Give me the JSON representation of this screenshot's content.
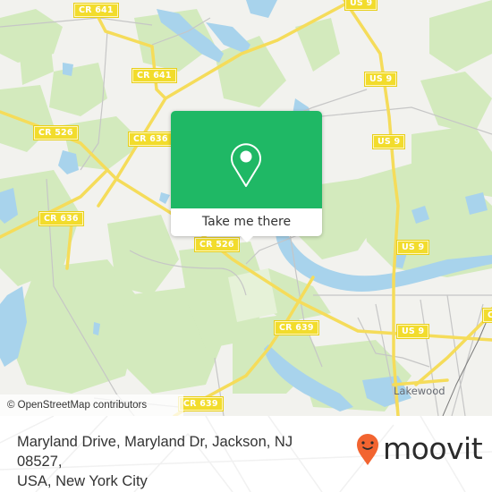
{
  "map": {
    "colors": {
      "land": "#f2f2ee",
      "forest": "#cfe8b4",
      "water": "#a8d3ec",
      "road_major": "#f7e27a",
      "road_minor": "#c8c8c8",
      "label_bg": "#f2dc2c"
    },
    "road_labels": [
      {
        "id": "cr641-top",
        "text": "CR 641"
      },
      {
        "id": "cr641-mid",
        "text": "CR 641"
      },
      {
        "id": "cr526-left",
        "text": "CR 526"
      },
      {
        "id": "cr636-top",
        "text": "CR 636"
      },
      {
        "id": "cr636-left",
        "text": "CR 636"
      },
      {
        "id": "cr526-center",
        "text": "CR 526"
      },
      {
        "id": "cr639-center",
        "text": "CR 639"
      },
      {
        "id": "cr639-bottom",
        "text": "CR 639"
      },
      {
        "id": "us9-top",
        "text": "US 9"
      },
      {
        "id": "us9-2",
        "text": "US 9"
      },
      {
        "id": "us9-3",
        "text": "US 9"
      },
      {
        "id": "us9-4",
        "text": "US 9"
      },
      {
        "id": "us9-5",
        "text": "US 9"
      },
      {
        "id": "cr-right-partial",
        "text": "C"
      }
    ],
    "place_labels": [
      {
        "id": "lakewood",
        "text": "Lakewood"
      }
    ],
    "attribution": "© OpenStreetMap contributors"
  },
  "popup": {
    "icon": "location-pin-icon",
    "cta_label": "Take me there",
    "color": "#1fb865"
  },
  "footer": {
    "address_line1": "Maryland Drive, Maryland Dr, Jackson, NJ 08527,",
    "address_line2": "USA, New York City",
    "brand": "moovit",
    "brand_icon": "moovit-pin-smile-icon",
    "brand_color": "#f26430"
  }
}
